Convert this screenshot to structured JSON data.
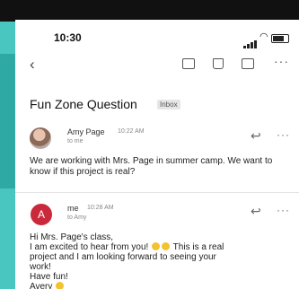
{
  "status_bar": {
    "time": "10:30"
  },
  "email": {
    "subject": "Fun Zone Question",
    "badge": "Inbox",
    "messages": [
      {
        "sender": "Amy Page",
        "date": "10:22 AM",
        "to": "to me",
        "body": "We are working with Mrs. Page in summer camp. We want to know if this project is real?"
      },
      {
        "avatar_letter": "A",
        "sender": "me",
        "date": "10:28 AM",
        "to": "to Amy",
        "body_lines": [
          "Hi Mrs. Page's class,",
          "I am excited to hear from you!",
          "This is a real",
          "project and I am looking forward to seeing your",
          "work!",
          "Have fun!",
          "Avery"
        ]
      }
    ]
  },
  "colors": {
    "background": "#49c6c0",
    "avatar_me": "#c9293a"
  }
}
